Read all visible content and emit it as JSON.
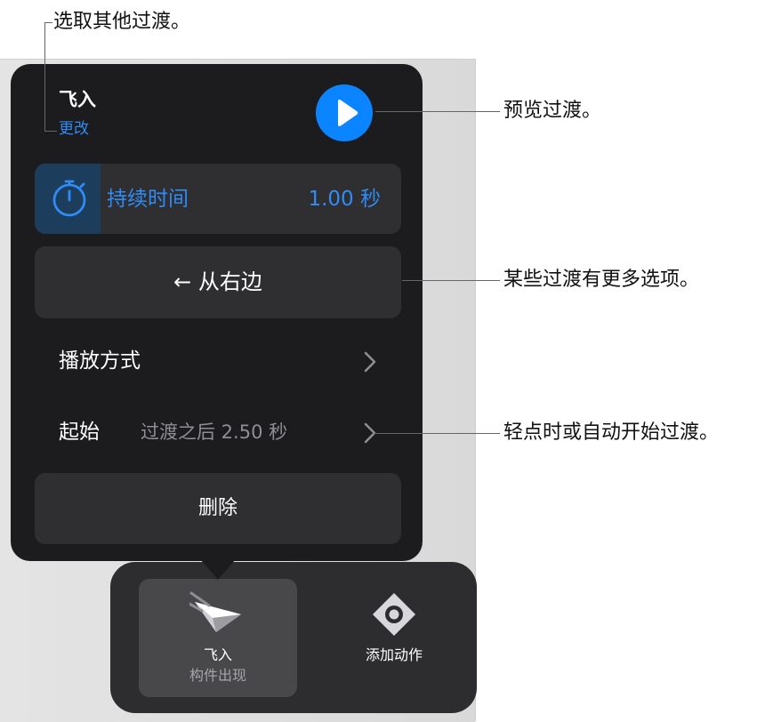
{
  "popover": {
    "title": "飞入",
    "change_link": "更改",
    "duration": {
      "label": "持续时间",
      "value": "1.00 秒",
      "fill_fraction": 0.18
    },
    "direction": {
      "arrow": "←",
      "label": "从右边"
    },
    "playback": {
      "label": "播放方式"
    },
    "start": {
      "label": "起始",
      "value": "过渡之后  2.50 秒"
    },
    "delete_label": "删除"
  },
  "toolbar": {
    "items": [
      {
        "label": "飞入",
        "sublabel": "构件出现",
        "icon": "paper-plane-icon",
        "selected": true
      },
      {
        "label": "添加动作",
        "icon": "action-target-icon",
        "selected": false
      }
    ]
  },
  "callouts": {
    "choose_transition": "选取其他过渡。",
    "preview": "预览过渡。",
    "more_options": "某些过渡有更多选项。",
    "start_mode": "轻点时或自动开始过渡。"
  },
  "colors": {
    "accent": "#0a84ff",
    "link": "#2f8cf6",
    "popover_bg": "#1c1c1e",
    "row_bg": "#2f2f31"
  }
}
